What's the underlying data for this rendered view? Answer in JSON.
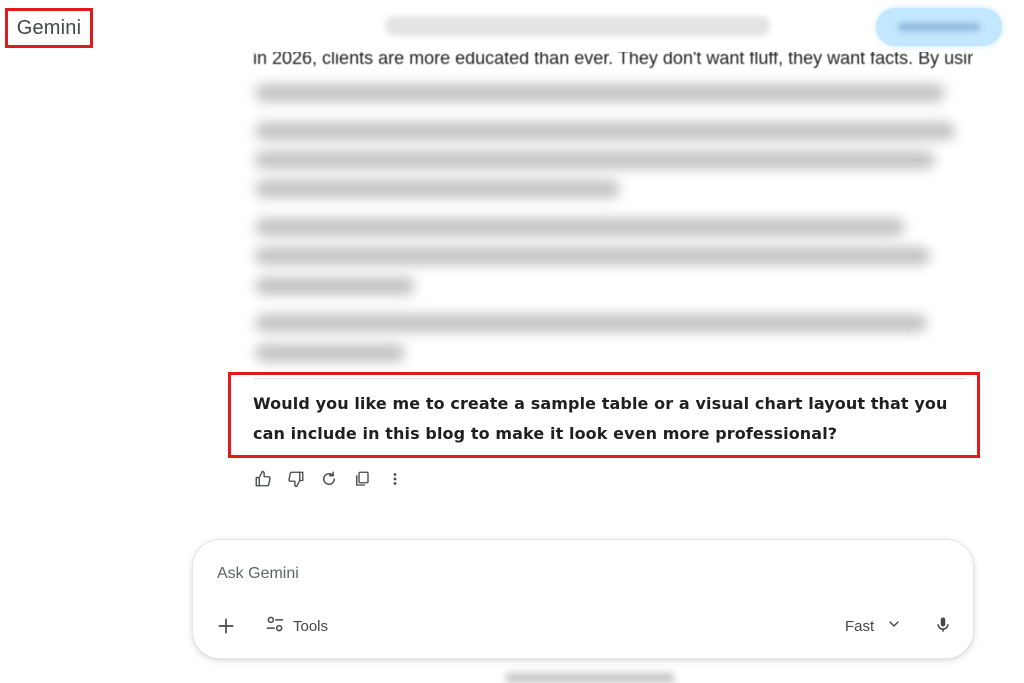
{
  "app": {
    "name": "Gemini"
  },
  "response": {
    "partial_line": "in 2026, clients are more educated than ever. They don't want fluff, they want facts. By using",
    "question": "Would you like me to create a sample table or a visual chart layout that you can include in this blog to make it look even more professional?"
  },
  "actions": {
    "icons": [
      "thumbs-up-icon",
      "thumbs-down-icon",
      "redo-icon",
      "copy-icon",
      "more-vert-icon"
    ]
  },
  "input": {
    "placeholder": "Ask Gemini",
    "tools_label": "Tools",
    "model_label": "Fast"
  },
  "colors": {
    "highlight": "#e01b1b",
    "share_button": "#c2e7ff",
    "text": "#1f1f1f",
    "icon": "#444746"
  }
}
